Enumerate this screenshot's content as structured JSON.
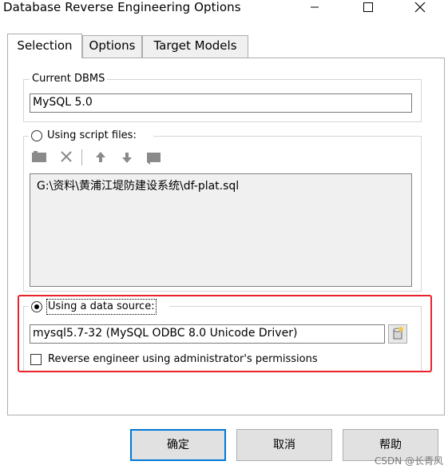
{
  "window": {
    "title": "Database Reverse Engineering Options"
  },
  "tabs": [
    {
      "label": "Selection"
    },
    {
      "label": "Options"
    },
    {
      "label": "Target Models"
    }
  ],
  "current_dbms": {
    "legend": "Current DBMS",
    "value": "MySQL 5.0"
  },
  "script_files": {
    "radio_label": "Using script files:",
    "selected": false,
    "toolbar_icons": [
      "add-file-icon",
      "delete-icon",
      "move-up-icon",
      "move-down-icon",
      "file-folder-icon"
    ],
    "files": [
      "G:\\资料\\黄浦江堤防建设系统\\df-plat.sql"
    ]
  },
  "data_source": {
    "radio_label": "Using a data source:",
    "selected": true,
    "value": "mysql5.7-32 (MySQL ODBC 8.0 Unicode Driver)",
    "checkbox_label": "Reverse engineer using administrator's permissions",
    "checkbox_checked": false,
    "highlight_color": "#e8232a"
  },
  "buttons": {
    "ok": "确定",
    "cancel": "取消",
    "help": "帮助"
  },
  "watermark": "CSDN @长青风"
}
